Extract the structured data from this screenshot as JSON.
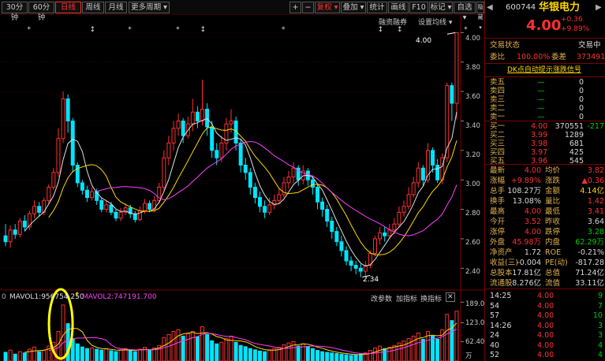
{
  "toolbar": {
    "buttons": [
      "30分钟",
      "60分钟",
      "日线",
      "周线",
      "月线",
      "更多周期 ▾"
    ],
    "right_buttons": [
      "+",
      "−",
      "复权 ▾",
      "叠加 ▾",
      "统计",
      "画线",
      "F10",
      "标记 ▾",
      "自选 ▾",
      "隐藏 ▾"
    ],
    "nav": [
      "◀",
      "▶"
    ]
  },
  "chart_header": {
    "margin_trading": "融资融券",
    "settings": "设置均线 ▾"
  },
  "price_axis": [
    "4.00",
    "3.80",
    "3.60",
    "3.40",
    "3.20",
    "3.00",
    "2.80",
    "2.60",
    "2.40"
  ],
  "annotations": {
    "high_label": "4.00",
    "low_label": "2.34"
  },
  "volume_bar": {
    "row_label": "0",
    "mavol1": "MAVOL1:956754.250",
    "arrow": "↑",
    "mavol2": "MAVOL2:747191.700",
    "delete_param": "改参数",
    "add_indicator": "加指标",
    "switch_indicator": "换指标",
    "close": "✕"
  },
  "volume_axis": [
    "189.00",
    "123.00",
    "62.40",
    "万"
  ],
  "stock": {
    "code": "600744",
    "name": "华银电力",
    "price": "4.00",
    "change": "+0.36",
    "change_pct": "+9.89%"
  },
  "status": {
    "label": "交易状态",
    "value": "交易中"
  },
  "ratio": {
    "label1": "委比",
    "value1": "100.00%",
    "label2": "委差",
    "value2": "373491"
  },
  "signal_link": "DK点自动提示涨跌信号",
  "asks": [
    {
      "label": "卖五",
      "price": "—",
      "vol": "0"
    },
    {
      "label": "卖四",
      "price": "—",
      "vol": "0"
    },
    {
      "label": "卖三",
      "price": "—",
      "vol": "0"
    },
    {
      "label": "卖二",
      "price": "—",
      "vol": "0"
    },
    {
      "label": "卖一",
      "price": "—",
      "vol": "0"
    }
  ],
  "bids": [
    {
      "label": "买一",
      "price": "4.00",
      "vol": "370551",
      "extra": "-217"
    },
    {
      "label": "买二",
      "price": "3.99",
      "vol": "1289",
      "extra": ""
    },
    {
      "label": "买三",
      "price": "3.98",
      "vol": "681",
      "extra": ""
    },
    {
      "label": "买四",
      "price": "3.97",
      "vol": "425",
      "extra": ""
    },
    {
      "label": "买五",
      "price": "3.96",
      "vol": "545",
      "extra": ""
    }
  ],
  "quote": [
    {
      "l1": "最新",
      "v1": "4.00",
      "c1": "r",
      "l2": "均价",
      "v2": "3.82",
      "c2": "r"
    },
    {
      "l1": "涨幅",
      "v1": "+9.89%",
      "c1": "r",
      "l2": "涨跌",
      "v2": "▲0.36",
      "c2": "r"
    },
    {
      "l1": "总手",
      "v1": "108.27万",
      "c1": "w",
      "l2": "金额",
      "v2": "4.14亿",
      "c2": "y"
    },
    {
      "l1": "换手",
      "v1": "13.08%",
      "c1": "w",
      "l2": "量比",
      "v2": "1.42",
      "c2": "r"
    },
    {
      "l1": "最高",
      "v1": "4.00",
      "c1": "r",
      "l2": "最低",
      "v2": "3.41",
      "c2": "r"
    },
    {
      "l1": "今开",
      "v1": "3.52",
      "c1": "r",
      "l2": "昨收",
      "v2": "3.64",
      "c2": "w"
    },
    {
      "l1": "涨停",
      "v1": "4.00",
      "c1": "r",
      "l2": "跌停",
      "v2": "3.28",
      "c2": "g"
    },
    {
      "l1": "外盘",
      "v1": "45.98万",
      "c1": "r",
      "l2": "内盘",
      "v2": "62.29万",
      "c2": "g"
    },
    {
      "l1": "净资产",
      "v1": "1.72",
      "c1": "w",
      "l2": "ROE",
      "v2": "-0.21%",
      "c2": "w"
    },
    {
      "l1": "收益(三)",
      "v1": "-0.004",
      "c1": "w",
      "l2": "PE(动)",
      "v2": "-817.28",
      "c2": "w"
    },
    {
      "l1": "总股本",
      "v1": "17.81亿",
      "c1": "w",
      "l2": "总值",
      "v2": "71.24亿",
      "c2": "w"
    },
    {
      "l1": "流通股",
      "v1": "8.276亿",
      "c1": "w",
      "l2": "流值",
      "v2": "33.11亿",
      "c2": "w"
    }
  ],
  "ticks": [
    {
      "time": "14:25",
      "price": "4.00",
      "vol": "9"
    },
    {
      "time": "54",
      "price": "4.00",
      "vol": "7"
    },
    {
      "time": "57",
      "price": "4.00",
      "vol": "10"
    },
    {
      "time": "14:26",
      "price": "4.00",
      "vol": "3"
    },
    {
      "time": "24",
      "price": "4.00",
      "vol": "3"
    },
    {
      "time": "40",
      "price": "4.00",
      "vol": "4"
    },
    {
      "time": "52",
      "price": "4.00",
      "vol": "4"
    }
  ],
  "candles": [
    [
      2.62,
      2.58,
      2.7,
      2.55
    ],
    [
      2.58,
      2.66,
      2.69,
      2.54
    ],
    [
      2.66,
      2.63,
      2.7,
      2.6
    ],
    [
      2.63,
      2.72,
      2.74,
      2.61
    ],
    [
      2.72,
      2.68,
      2.76,
      2.65
    ],
    [
      2.68,
      2.77,
      2.79,
      2.66
    ],
    [
      2.77,
      2.82,
      2.86,
      2.74
    ],
    [
      2.82,
      2.78,
      2.85,
      2.75
    ],
    [
      2.78,
      2.86,
      2.88,
      2.76
    ],
    [
      2.86,
      2.95,
      2.97,
      2.84
    ],
    [
      2.95,
      3.05,
      3.08,
      2.93
    ],
    [
      3.05,
      3.28,
      3.35,
      3.02
    ],
    [
      3.28,
      3.55,
      3.6,
      3.25
    ],
    [
      3.55,
      3.4,
      3.58,
      3.32
    ],
    [
      3.4,
      3.1,
      3.42,
      3.05
    ],
    [
      3.1,
      2.98,
      3.12,
      2.95
    ],
    [
      2.98,
      2.93,
      3.0,
      2.9
    ],
    [
      2.93,
      2.88,
      2.96,
      2.85
    ],
    [
      2.88,
      2.92,
      2.95,
      2.86
    ],
    [
      2.92,
      2.86,
      2.94,
      2.83
    ],
    [
      2.86,
      2.8,
      2.88,
      2.78
    ],
    [
      2.8,
      2.83,
      2.86,
      2.78
    ],
    [
      2.83,
      2.78,
      2.85,
      2.76
    ],
    [
      2.78,
      2.74,
      2.8,
      2.72
    ],
    [
      2.74,
      2.78,
      2.81,
      2.72
    ],
    [
      2.78,
      2.81,
      2.84,
      2.76
    ],
    [
      2.81,
      2.77,
      2.83,
      2.74
    ],
    [
      2.77,
      2.73,
      2.79,
      2.71
    ],
    [
      2.73,
      2.79,
      2.82,
      2.72
    ],
    [
      2.79,
      2.84,
      2.87,
      2.77
    ],
    [
      2.84,
      2.8,
      2.86,
      2.78
    ],
    [
      2.8,
      2.86,
      2.89,
      2.78
    ],
    [
      2.86,
      2.95,
      2.98,
      2.84
    ],
    [
      2.95,
      3.15,
      3.2,
      2.93
    ],
    [
      3.15,
      3.25,
      3.3,
      3.1
    ],
    [
      3.25,
      3.35,
      3.4,
      3.2
    ],
    [
      3.35,
      3.4,
      3.45,
      3.3
    ],
    [
      3.4,
      3.3,
      3.42,
      3.25
    ],
    [
      3.3,
      3.38,
      3.43,
      3.28
    ],
    [
      3.38,
      3.46,
      3.55,
      3.33
    ],
    [
      3.46,
      3.4,
      3.5,
      3.35
    ],
    [
      3.4,
      3.48,
      3.68,
      3.37
    ],
    [
      3.48,
      3.36,
      3.52,
      3.3
    ],
    [
      3.36,
      3.2,
      3.4,
      3.15
    ],
    [
      3.2,
      3.15,
      3.25,
      3.1
    ],
    [
      3.15,
      3.25,
      3.3,
      3.12
    ],
    [
      3.25,
      3.38,
      3.42,
      3.2
    ],
    [
      3.38,
      3.4,
      3.48,
      3.32
    ],
    [
      3.4,
      3.25,
      3.43,
      3.2
    ],
    [
      3.25,
      3.1,
      3.28,
      3.05
    ],
    [
      3.1,
      3.05,
      3.15,
      3.0
    ],
    [
      3.05,
      2.95,
      3.08,
      2.9
    ],
    [
      2.95,
      2.88,
      2.98,
      2.84
    ],
    [
      2.88,
      2.82,
      2.92,
      2.78
    ],
    [
      2.82,
      2.78,
      2.86,
      2.74
    ],
    [
      2.78,
      2.83,
      2.88,
      2.76
    ],
    [
      2.83,
      2.86,
      2.9,
      2.8
    ],
    [
      2.86,
      2.9,
      2.94,
      2.84
    ],
    [
      2.9,
      2.98,
      3.02,
      2.88
    ],
    [
      2.98,
      3.02,
      3.06,
      2.94
    ],
    [
      3.02,
      3.08,
      3.12,
      2.98
    ],
    [
      3.08,
      3.0,
      3.1,
      2.96
    ],
    [
      3.0,
      3.06,
      3.1,
      2.97
    ],
    [
      3.06,
      3.0,
      3.08,
      2.96
    ],
    [
      3.0,
      2.95,
      3.03,
      2.9
    ],
    [
      2.95,
      2.85,
      2.97,
      2.8
    ],
    [
      2.85,
      2.8,
      2.88,
      2.75
    ],
    [
      2.8,
      2.72,
      2.83,
      2.68
    ],
    [
      2.72,
      2.65,
      2.75,
      2.6
    ],
    [
      2.65,
      2.58,
      2.68,
      2.55
    ],
    [
      2.58,
      2.52,
      2.62,
      2.48
    ],
    [
      2.52,
      2.45,
      2.55,
      2.42
    ],
    [
      2.45,
      2.42,
      2.48,
      2.38
    ],
    [
      2.42,
      2.4,
      2.45,
      2.36
    ],
    [
      2.4,
      2.38,
      2.43,
      2.34
    ],
    [
      2.38,
      2.42,
      2.45,
      2.35
    ],
    [
      2.42,
      2.5,
      2.52,
      2.4
    ],
    [
      2.5,
      2.6,
      2.62,
      2.48
    ],
    [
      2.6,
      2.64,
      2.68,
      2.56
    ],
    [
      2.64,
      2.62,
      2.68,
      2.58
    ],
    [
      2.62,
      2.66,
      2.7,
      2.6
    ],
    [
      2.66,
      2.7,
      2.74,
      2.63
    ],
    [
      2.7,
      2.78,
      2.82,
      2.68
    ],
    [
      2.78,
      2.82,
      2.86,
      2.75
    ],
    [
      2.82,
      2.9,
      2.95,
      2.8
    ],
    [
      2.9,
      2.98,
      3.02,
      2.88
    ],
    [
      2.98,
      3.08,
      3.12,
      2.95
    ],
    [
      3.08,
      3.0,
      3.1,
      2.96
    ],
    [
      3.0,
      3.2,
      3.25,
      2.98
    ],
    [
      3.2,
      3.1,
      3.22,
      3.05
    ],
    [
      3.1,
      3.0,
      3.14,
      2.98
    ],
    [
      3.0,
      3.15,
      3.18,
      2.97
    ],
    [
      3.15,
      3.64,
      3.66,
      3.12
    ],
    [
      3.64,
      3.52,
      3.66,
      3.4
    ],
    [
      3.52,
      4.0,
      4.0,
      3.41
    ]
  ],
  "volumes": [
    28,
    35,
    22,
    30,
    26,
    38,
    45,
    30,
    34,
    48,
    60,
    95,
    180,
    120,
    70,
    55,
    45,
    40,
    42,
    38,
    35,
    40,
    33,
    30,
    36,
    40,
    34,
    30,
    38,
    44,
    36,
    42,
    50,
    75,
    85,
    95,
    100,
    80,
    88,
    95,
    78,
    110,
    85,
    65,
    55,
    60,
    72,
    80,
    60,
    50,
    46,
    40,
    36,
    32,
    30,
    36,
    40,
    44,
    52,
    58,
    62,
    48,
    55,
    46,
    40,
    34,
    30,
    28,
    26,
    24,
    22,
    20,
    18,
    20,
    22,
    26,
    34,
    42,
    48,
    40,
    44,
    50,
    58,
    64,
    72,
    80,
    90,
    70,
    95,
    80,
    70,
    100,
    150,
    130,
    160
  ],
  "colors": {
    "up": "#ff3030",
    "down": "#00e5ff",
    "ma5": "#e0e0e0",
    "ma10": "#ffd700",
    "ma20": "#ff40ff",
    "frame": "#7a0000"
  }
}
